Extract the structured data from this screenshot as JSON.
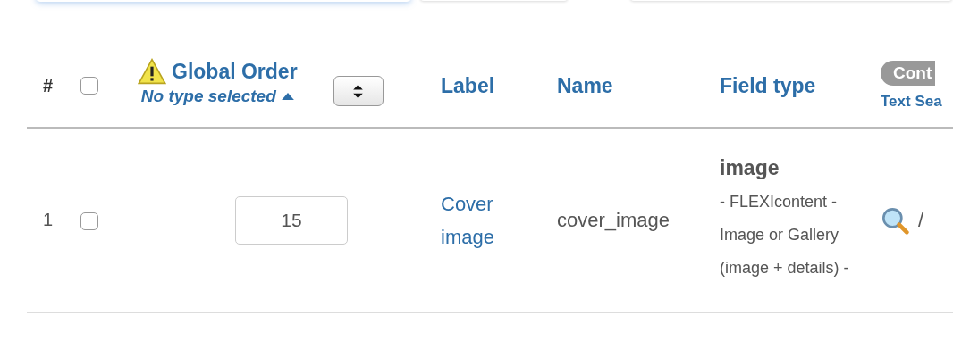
{
  "header": {
    "number": "#",
    "select_all": {
      "checked": false
    },
    "global_order": {
      "title": "Global Order",
      "sort_label": "No type selected"
    },
    "label": "Label",
    "name": "Name",
    "field_type": "Field type",
    "column_7": {
      "badge": "Cont",
      "link": "Text Sea"
    }
  },
  "rows": [
    {
      "number": "1",
      "checked": false,
      "order": "15",
      "label": "Cover image",
      "name": "cover_image",
      "type": "image",
      "type_description": "- FLEXIcontent - Image or Gallery (image + details) -",
      "column_7": "/"
    }
  ]
}
